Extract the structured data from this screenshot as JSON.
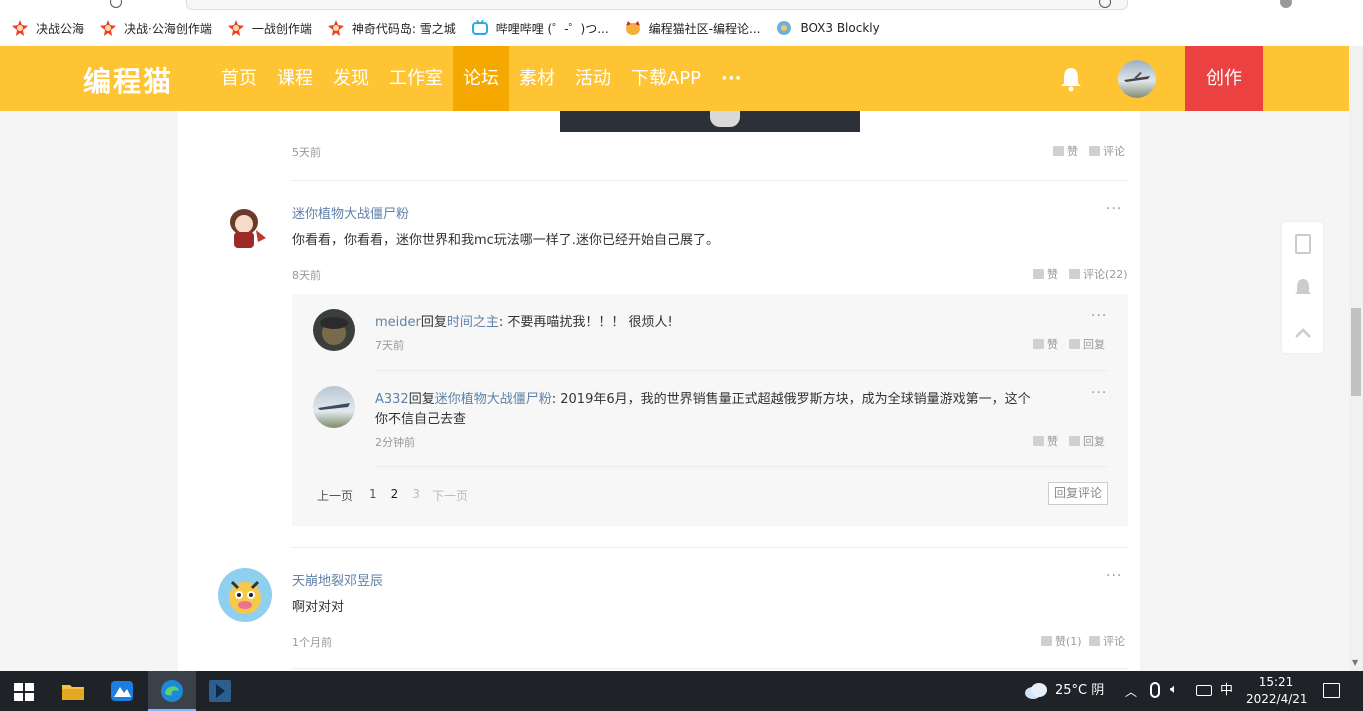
{
  "browser": {
    "bookmarks": [
      {
        "label": "决战公海",
        "icon": "game-red-icon"
      },
      {
        "label": "决战·公海创作端",
        "icon": "game-red-icon"
      },
      {
        "label": "一战创作端",
        "icon": "game-red-icon"
      },
      {
        "label": "神奇代码岛: 雪之城",
        "icon": "game-red-icon"
      },
      {
        "label": "哔哩哔哩 (゜-゜)つ...",
        "icon": "bilibili-icon"
      },
      {
        "label": "编程猫社区-编程论...",
        "icon": "codemao-icon"
      },
      {
        "label": "BOX3 Blockly",
        "icon": "box3-icon"
      }
    ]
  },
  "header": {
    "logo": "编程猫",
    "nav": [
      "首页",
      "课程",
      "发现",
      "工作室",
      "论坛",
      "素材",
      "活动",
      "下载APP",
      "···"
    ],
    "active_index": 4,
    "create_label": "创作",
    "accent": "#fec433",
    "create_color": "#ec4141"
  },
  "post_tail": {
    "time": "5天前",
    "like": "赞",
    "comment": "评论"
  },
  "comments": [
    {
      "author": "迷你植物大战僵尸粉",
      "text": "你看看，你看看，迷你世界和我mc玩法哪一样了.迷你已经开始自己展了。",
      "time": "8天前",
      "like": "赞",
      "comment": "评论(22)",
      "more": "···",
      "replies": [
        {
          "author": "meider",
          "reply_word": "回复",
          "target": "时间之主",
          "text": ": 不要再喵扰我！！！ 很烦人!",
          "time": "7天前",
          "like": "赞",
          "reply": "回复",
          "more": "···"
        },
        {
          "author": "A332",
          "reply_word": "回复",
          "target": "迷你植物大战僵尸粉",
          "text": ": 2019年6月，我的世界销售量正式超越俄罗斯方块，成为全球销量游戏第一，这个",
          "text2": "你不信自己去查",
          "time": "2分钟前",
          "like": "赞",
          "reply": "回复",
          "more": "···"
        }
      ],
      "pager": {
        "prev": "上一页",
        "pages": [
          "1",
          "2",
          "3"
        ],
        "current": "2",
        "next": "下一页",
        "reply_button": "回复评论"
      }
    },
    {
      "author": "天崩地裂邓昱辰",
      "text": "啊对对对",
      "time": "1个月前",
      "like": "赞(1)",
      "comment": "评论",
      "more": "···"
    }
  ],
  "taskbar": {
    "weather": "25°C  阴",
    "ime": "中",
    "time": "15:21",
    "date": "2022/4/21"
  }
}
